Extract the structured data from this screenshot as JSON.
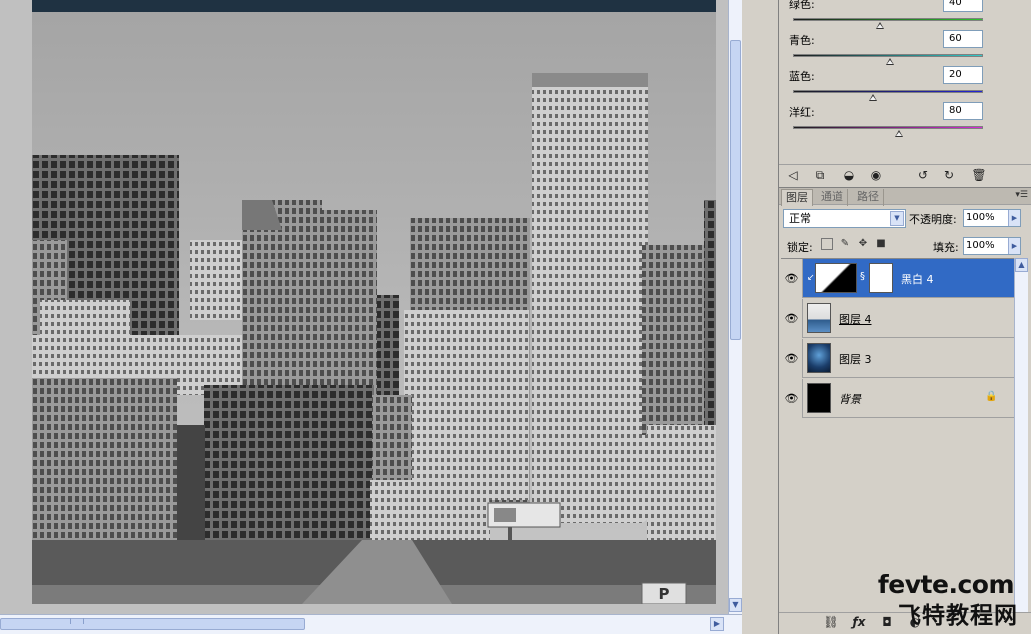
{
  "adjustments": {
    "sliders": [
      {
        "label": "绿色:",
        "value": "40",
        "position_fraction": 0.46,
        "gradient": [
          "#1c1c1c",
          "#2dc22d"
        ]
      },
      {
        "label": "青色:",
        "value": "60",
        "position_fraction": 0.51,
        "gradient": [
          "#1c1c1c",
          "#2fc9c9"
        ]
      },
      {
        "label": "蓝色:",
        "value": "20",
        "position_fraction": 0.42,
        "gradient": [
          "#1c1c1c",
          "#2424d8"
        ]
      },
      {
        "label": "洋红:",
        "value": "80",
        "position_fraction": 0.56,
        "gradient": [
          "#1c1c1c",
          "#d82ad8"
        ]
      }
    ]
  },
  "layers_panel": {
    "tabs": [
      {
        "label": "图层",
        "active": true
      },
      {
        "label": "通道",
        "active": false
      },
      {
        "label": "路径",
        "active": false
      }
    ],
    "blend_mode": "正常",
    "opacity_label": "不透明度:",
    "opacity_value": "100%",
    "lock_label": "锁定:",
    "fill_label": "填充:",
    "fill_value": "100%",
    "layers": [
      {
        "name": "黑白 4",
        "type": "adjustment",
        "selected": true
      },
      {
        "name": "图层 4",
        "type": "pixel",
        "selected": false
      },
      {
        "name": "图层 3",
        "type": "pixel",
        "selected": false
      },
      {
        "name": "背景",
        "type": "background",
        "selected": false,
        "locked": true
      }
    ]
  },
  "canvas": {
    "billboard_text": "P"
  },
  "watermark": {
    "line1": "fevte.com",
    "line2": "飞特教程网"
  },
  "colors": {
    "selection": "#316ac5",
    "panel_bg": "#d4d0c8",
    "scroll_blue": "#c6d5f3"
  }
}
